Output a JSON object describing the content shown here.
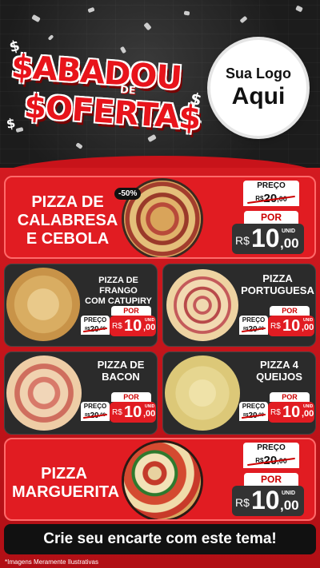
{
  "header": {
    "title_line1": "$ABADOU",
    "title_de": "DE",
    "title_line2": "$OFERTA$",
    "logo_line1": "Sua Logo",
    "logo_line2": "Aqui"
  },
  "featured": [
    {
      "name": "PIZZA DE CALABRESA E CEBOLA",
      "name_lines": [
        "PIZZA DE",
        "CALABRESA",
        "E CEBOLA"
      ],
      "badge": "-50%",
      "preco_label": "PREÇO",
      "old_currency": "R$",
      "old_int": "20",
      "old_dec": ",00",
      "por_label": "POR",
      "new_currency": "R$",
      "new_int": "10",
      "new_dec": ",00",
      "unid": "UNID"
    },
    {
      "name": "PIZZA MARGUERITA",
      "name_lines": [
        "PIZZA",
        "MARGUERITA"
      ],
      "preco_label": "PREÇO",
      "old_currency": "R$",
      "old_int": "20",
      "old_dec": ",00",
      "por_label": "POR",
      "new_currency": "R$",
      "new_int": "10",
      "new_dec": ",00",
      "unid": "UNID"
    }
  ],
  "grid": [
    {
      "name_lines": [
        "PIZZA DE FRANGO",
        "COM CATUPIRY"
      ],
      "preco_label": "PREÇO",
      "old_currency": "R$",
      "old_int": "20",
      "old_dec": ",00",
      "por_label": "POR",
      "new_currency": "R$",
      "new_int": "10",
      "new_dec": ",00",
      "unid": "UNID"
    },
    {
      "name_lines": [
        "PIZZA",
        "PORTUGUESA"
      ],
      "preco_label": "PREÇO",
      "old_currency": "R$",
      "old_int": "20",
      "old_dec": ",00",
      "por_label": "POR",
      "new_currency": "R$",
      "new_int": "10",
      "new_dec": ",00",
      "unid": "UNID"
    },
    {
      "name_lines": [
        "PIZZA DE",
        "BACON"
      ],
      "preco_label": "PREÇO",
      "old_currency": "R$",
      "old_int": "20",
      "old_dec": ",00",
      "por_label": "POR",
      "new_currency": "R$",
      "new_int": "10",
      "new_dec": ",00",
      "unid": "UNID"
    },
    {
      "name_lines": [
        "PIZZA 4",
        "QUEIJOS"
      ],
      "preco_label": "PREÇO",
      "old_currency": "R$",
      "old_int": "20",
      "old_dec": ",00",
      "por_label": "POR",
      "new_currency": "R$",
      "new_int": "10",
      "new_dec": ",00",
      "unid": "UNID"
    }
  ],
  "cta": "Crie seu encarte com este tema!",
  "footnote": "*Imagens Meramente Ilustrativas",
  "colors": {
    "brand_red": "#e11c22",
    "dark_card": "#2b2b2b"
  }
}
